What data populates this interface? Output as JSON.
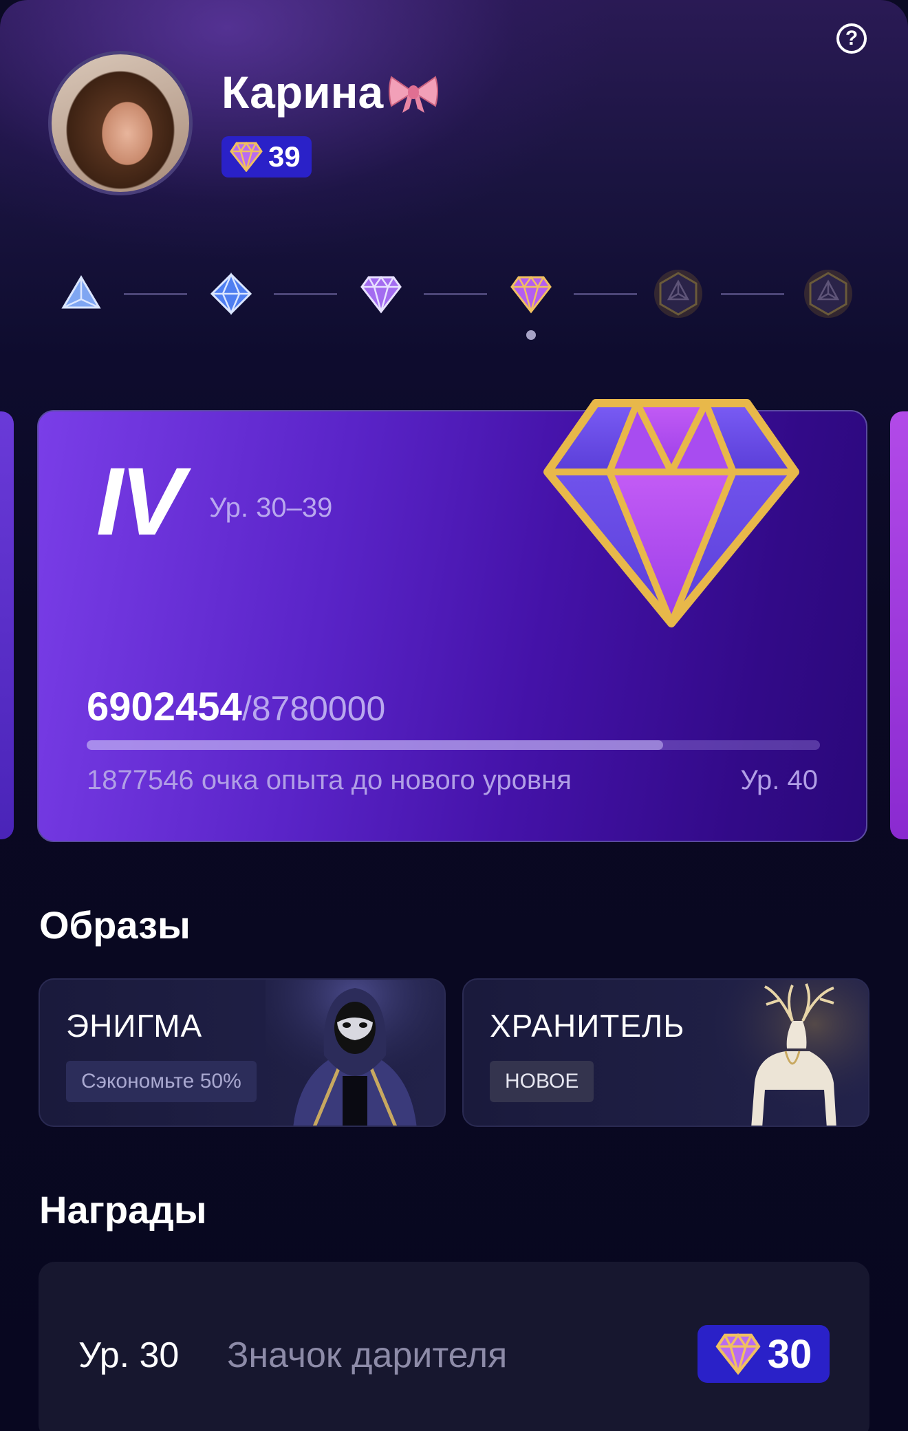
{
  "profile": {
    "name": "Карина",
    "level": "39"
  },
  "tier_card": {
    "tier": "IV",
    "range": "Ур. 30–39",
    "xp_current": "6902454",
    "xp_total": "/8780000",
    "progress_fraction": 0.786,
    "xp_hint": "1877546 очка опыта до нового уровня",
    "next_level": "Ур. 40"
  },
  "tiers": [
    {
      "icon": "triangle-gem-icon",
      "unlocked": true
    },
    {
      "icon": "rhombus-gem-icon",
      "unlocked": true
    },
    {
      "icon": "purple-diamond-icon",
      "unlocked": true
    },
    {
      "icon": "gold-diamond-icon",
      "unlocked": true,
      "current": true
    },
    {
      "icon": "locked-hexagon-icon",
      "unlocked": false
    },
    {
      "icon": "locked-hexagon-icon",
      "unlocked": false
    }
  ],
  "looks": {
    "title": "Образы",
    "items": [
      {
        "name": "ЭНИГМА",
        "tag": "Сэкономьте 50%"
      },
      {
        "name": "ХРАНИТЕЛЬ",
        "tag": "НОВОЕ"
      }
    ]
  },
  "rewards": {
    "title": "Награды",
    "items": [
      {
        "level": "Ур. 30",
        "name": "Значок дарителя",
        "badge_value": "30"
      }
    ]
  },
  "colors": {
    "accent": "#2a21c8",
    "card_start": "#7a3ee8",
    "card_end": "#2a087a",
    "gold": "#e8b84a"
  }
}
